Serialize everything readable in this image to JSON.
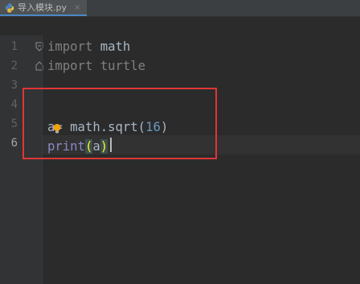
{
  "editor": {
    "tab": {
      "filename": "导入模块.py",
      "close_glyph": "×",
      "icon": "python-file-icon"
    },
    "line_numbers": [
      "1",
      "2",
      "3",
      "4",
      "5",
      "6"
    ],
    "current_line": "6",
    "code": {
      "line1": {
        "keyword": "import",
        "module": "math"
      },
      "line2": {
        "keyword": "import",
        "module": "turtle"
      },
      "line5": {
        "var": "a",
        "op": "= ",
        "call": "math.sqrt(",
        "num": "16",
        "close": ")"
      },
      "line6": {
        "builtin": "print",
        "open": "(",
        "arg": "a",
        "close": ")"
      }
    },
    "intention_icon": "lightbulb-icon",
    "colors": {
      "background": "#2b2b2b",
      "keyword": "#cc7832",
      "unused": "#808080",
      "number": "#6897bb",
      "builtin": "#8888c6",
      "annotation_box": "#e03535"
    }
  }
}
